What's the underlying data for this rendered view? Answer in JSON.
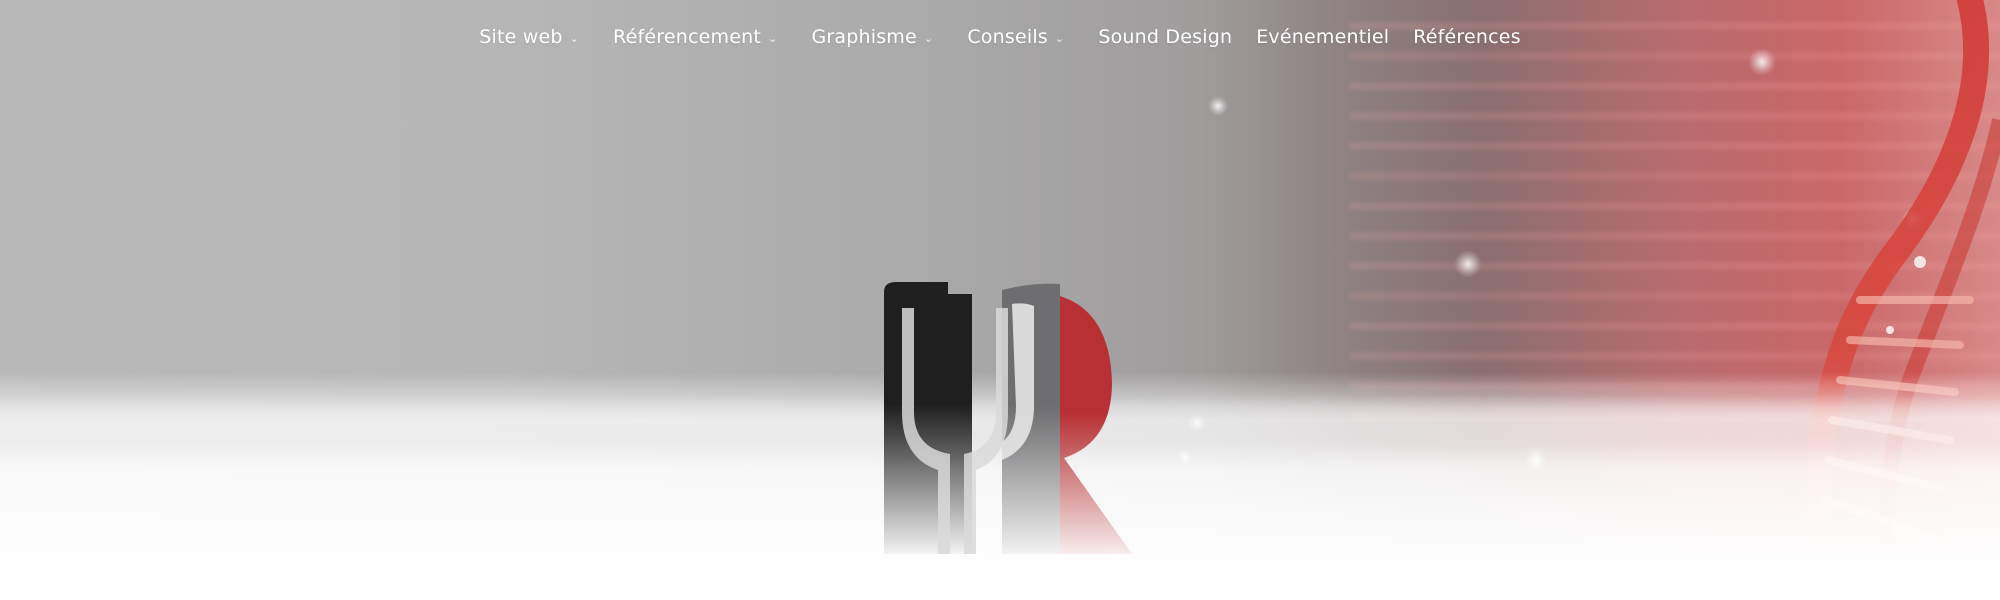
{
  "nav": {
    "items": [
      {
        "label": "Site web",
        "has_dropdown": true,
        "icon": "chevron-down-icon"
      },
      {
        "label": "Référencement",
        "has_dropdown": true,
        "icon": "chevron-down-icon"
      },
      {
        "label": "Graphisme",
        "has_dropdown": true,
        "icon": "chevron-down-icon"
      },
      {
        "label": "Conseils",
        "has_dropdown": true,
        "icon": "chevron-down-icon"
      },
      {
        "label": "Sound Design",
        "has_dropdown": false
      },
      {
        "label": "Evénementiel",
        "has_dropdown": false
      },
      {
        "label": "Références",
        "has_dropdown": false
      }
    ],
    "chevron_glyph": "⌄"
  },
  "logo": {
    "icon": "psi-r-logo-icon",
    "colors": {
      "black": "#1f1f1f",
      "grey": "#707070",
      "red": "#b83033"
    }
  },
  "hero": {
    "background_image": "dna-helix-image",
    "accent_color": "#c9393b"
  }
}
